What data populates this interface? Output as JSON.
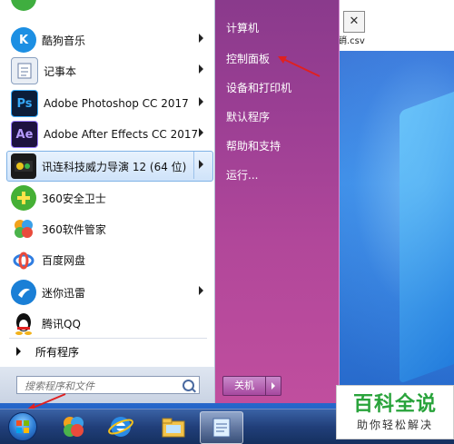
{
  "desktop": {
    "window_file_label": "销.csv",
    "close_glyph": "✕"
  },
  "start_menu": {
    "programs": [
      {
        "label": "酷狗音乐",
        "icon": "kugou-music-icon",
        "has_submenu": true
      },
      {
        "label": "记事本",
        "icon": "notepad-icon",
        "has_submenu": true
      },
      {
        "label": "Adobe Photoshop CC 2017",
        "icon": "photoshop-icon",
        "icon_text": "Ps",
        "has_submenu": true
      },
      {
        "label": "Adobe After Effects CC 2017",
        "icon": "after-effects-icon",
        "icon_text": "Ae",
        "has_submenu": true
      },
      {
        "label": "讯连科技威力导演 12 (64 位)",
        "icon": "powerdirector-icon",
        "has_submenu": true,
        "highlighted": true
      },
      {
        "label": "360安全卫士",
        "icon": "360-security-icon",
        "has_submenu": false
      },
      {
        "label": "360软件管家",
        "icon": "360-software-manager-icon",
        "has_submenu": false
      },
      {
        "label": "百度网盘",
        "icon": "baidu-netdisk-icon",
        "has_submenu": false
      },
      {
        "label": "迷你迅雷",
        "icon": "mini-thunder-icon",
        "has_submenu": true
      },
      {
        "label": "腾讯QQ",
        "icon": "qq-penguin-icon",
        "has_submenu": false
      }
    ],
    "all_programs": "所有程序",
    "search_placeholder": "搜索程序和文件",
    "right_items": [
      {
        "label": "计算机",
        "name": "computer"
      },
      {
        "label": "控制面板",
        "name": "control-panel"
      },
      {
        "label": "设备和打印机",
        "name": "devices-and-printers"
      },
      {
        "label": "默认程序",
        "name": "default-programs"
      },
      {
        "label": "帮助和支持",
        "name": "help-and-support"
      },
      {
        "label": "运行...",
        "name": "run"
      }
    ],
    "shutdown_label": "关机"
  },
  "taskbar": {
    "buttons": [
      "start-orb",
      "360-browser-icon",
      "ie-browser-icon",
      "file-explorer-icon",
      "notepad-app-icon"
    ]
  },
  "watermark": {
    "title": "百科全说",
    "subtitle": "助你轻松解决"
  },
  "colors": {
    "right_pane": "#a5449a",
    "taskbar": "#213f7a",
    "annotation_arrow": "#e02020",
    "watermark_green": "#29a33b"
  }
}
